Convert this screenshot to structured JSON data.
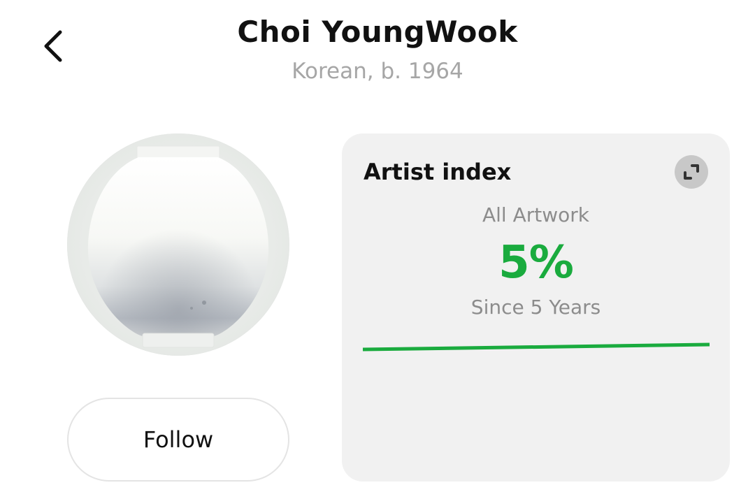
{
  "header": {
    "artist_name": "Choi YoungWook",
    "artist_meta": "Korean, b. 1964"
  },
  "actions": {
    "follow_label": "Follow"
  },
  "artist_index": {
    "title": "Artist index",
    "label": "All Artwork",
    "value": "5%",
    "period": "Since 5 Years"
  },
  "icons": {
    "back": "chevron-left-icon",
    "expand": "expand-icon"
  },
  "colors": {
    "accent_green": "#1aab3e",
    "card_bg": "#f1f1f1",
    "muted_text": "#a6a6a6"
  }
}
